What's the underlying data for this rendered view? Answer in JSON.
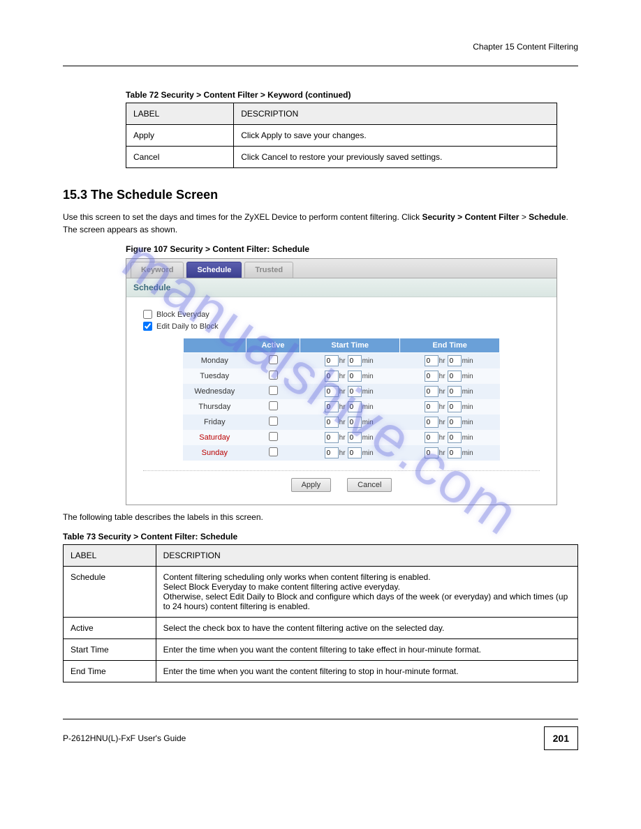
{
  "header": {
    "line": "Chapter 15 Content Filtering"
  },
  "footer": {
    "left": "P-2612HNU(L)-FxF User's Guide",
    "page": "201"
  },
  "watermark": "manualshive.com",
  "table72_cont": {
    "caption": "Table 72   Security > Content Filter > Keyword (continued)",
    "col_label": "LABEL",
    "col_desc": "DESCRIPTION",
    "rows": [
      {
        "label": "Apply",
        "desc": "Click Apply to save your changes."
      },
      {
        "label": "Cancel",
        "desc": "Click Cancel to restore your previously saved settings."
      }
    ]
  },
  "section_schedule": {
    "heading": "15.3  The Schedule Screen",
    "para1_before": "Use this screen to set the days and times for the ZyXEL Device to perform content filtering. Click ",
    "para1_bold": "Security > Content Filter",
    "para1_mid": " > ",
    "para1_bold2": "Schedule",
    "para1_after": ". The screen appears as shown.",
    "figure_label": "Figure 107   Security > Content Filter: Schedule"
  },
  "shot": {
    "tabs": [
      "Keyword",
      "Schedule",
      "Trusted"
    ],
    "active_tab": 1,
    "panel_title": "Schedule",
    "chk_block_everyday": "Block Everyday",
    "chk_edit_daily": "Edit Daily to Block",
    "block_everyday_checked": false,
    "edit_daily_checked": true,
    "thead": [
      "",
      "Active",
      "Start Time",
      "End Time"
    ],
    "days": [
      {
        "name": "Monday",
        "weekend": false,
        "active": false,
        "sh": "0",
        "sm": "0",
        "eh": "0",
        "em": "0"
      },
      {
        "name": "Tuesday",
        "weekend": false,
        "active": false,
        "sh": "0",
        "sm": "0",
        "eh": "0",
        "em": "0"
      },
      {
        "name": "Wednesday",
        "weekend": false,
        "active": false,
        "sh": "0",
        "sm": "0",
        "eh": "0",
        "em": "0"
      },
      {
        "name": "Thursday",
        "weekend": false,
        "active": false,
        "sh": "0",
        "sm": "0",
        "eh": "0",
        "em": "0"
      },
      {
        "name": "Friday",
        "weekend": false,
        "active": false,
        "sh": "0",
        "sm": "0",
        "eh": "0",
        "em": "0"
      },
      {
        "name": "Saturday",
        "weekend": true,
        "active": false,
        "sh": "0",
        "sm": "0",
        "eh": "0",
        "em": "0"
      },
      {
        "name": "Sunday",
        "weekend": true,
        "active": false,
        "sh": "0",
        "sm": "0",
        "eh": "0",
        "em": "0"
      }
    ],
    "hr_label": "hr",
    "min_label": "min",
    "btn_apply": "Apply",
    "btn_cancel": "Cancel"
  },
  "table73_intro": "The following table describes the labels in this screen.",
  "table73": {
    "caption": "Table 73   Security > Content Filter: Schedule",
    "col_label": "LABEL",
    "col_desc": "DESCRIPTION",
    "rows": [
      {
        "label": "Schedule",
        "desc_lines": [
          "Content filtering scheduling only works when content filtering is enabled.",
          "Select Block Everyday to make content filtering active everyday.",
          "Otherwise, select Edit Daily to Block and configure which days of the week (or everyday) and which times (up to 24 hours) content filtering is enabled."
        ]
      },
      {
        "label": "Active",
        "desc_lines": [
          "Select the check box to have the content filtering active on the selected day."
        ]
      },
      {
        "label": "Start Time",
        "desc_lines": [
          "Enter the time when you want the content filtering to take effect in hour-minute format."
        ]
      },
      {
        "label": "End Time",
        "desc_lines": [
          "Enter the time when you want the content filtering to stop in hour-minute format."
        ]
      }
    ]
  }
}
